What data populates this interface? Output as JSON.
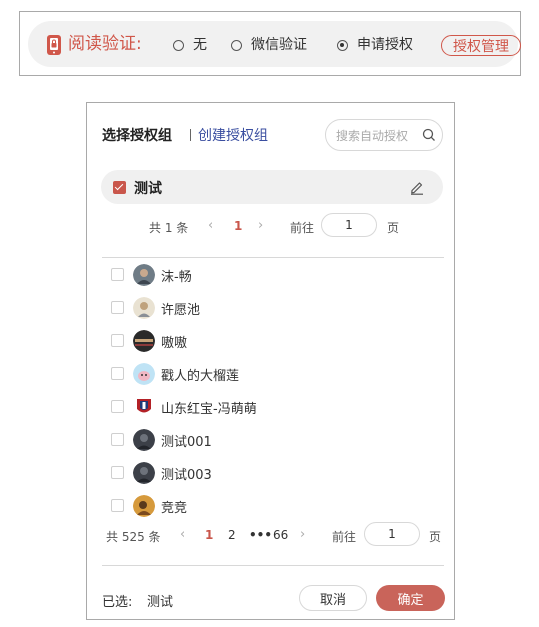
{
  "verify_bar": {
    "label": "阅读验证:",
    "options": [
      {
        "label": "无",
        "selected": false
      },
      {
        "label": "微信验证",
        "selected": false
      },
      {
        "label": "申请授权",
        "selected": true
      }
    ],
    "manage_button": "授权管理",
    "accent_color": "#d0574a"
  },
  "dialog": {
    "tab_select": "选择授权组",
    "tab_create": "创建授权组",
    "search_placeholder": "搜索自动授权",
    "group": {
      "name": "测试",
      "checked": true
    },
    "group_pager": {
      "total": "共 1 条",
      "pages": [
        "1"
      ],
      "current": "1",
      "goto_label": "前往",
      "goto_value": "1",
      "unit": "页"
    },
    "members": [
      {
        "name": "沫-畅",
        "icon": "avatar-photo"
      },
      {
        "name": "许愿池",
        "icon": "avatar-photo"
      },
      {
        "name": "嗷嗷",
        "icon": "avatar-photo"
      },
      {
        "name": "戳人的大榴莲",
        "icon": "avatar-cartoon"
      },
      {
        "name": "山东红宝-冯萌萌",
        "icon": "avatar-logo"
      },
      {
        "name": "测试001",
        "icon": "avatar-photo"
      },
      {
        "name": "测试003",
        "icon": "avatar-photo"
      },
      {
        "name": "竞竞",
        "icon": "avatar-photo"
      }
    ],
    "member_pager": {
      "total": "共 525 条",
      "pages": [
        "1",
        "2",
        "•••",
        "66"
      ],
      "current": "1",
      "goto_label": "前往",
      "goto_value": "1",
      "unit": "页"
    },
    "selected_label": "已选:",
    "selected_value": "测试",
    "cancel_label": "取消",
    "ok_label": "确定",
    "ok_color": "#c9645a"
  }
}
